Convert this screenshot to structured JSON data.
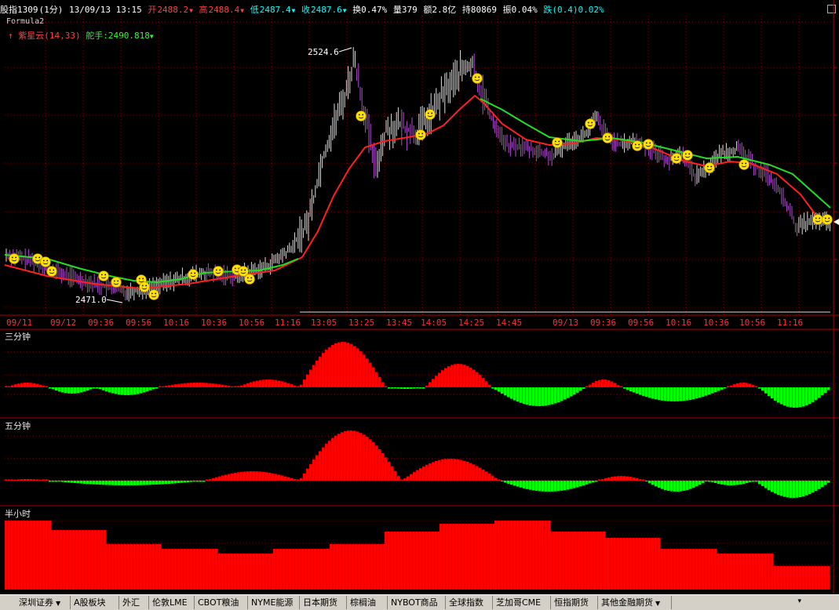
{
  "status": {
    "symbol": "股指1309",
    "period": "(1分)",
    "datetime": "13/09/13 13:15",
    "open_label": "开",
    "open": "2488.2",
    "high_label": "高",
    "high": "2488.4",
    "low_label": "低",
    "low": "2487.4",
    "close_label": "收",
    "close": "2487.6",
    "turnover": "换0.47%",
    "volume": "量379",
    "amount": "额2.8亿",
    "holding": "持80869",
    "amplitude": "振0.04%",
    "change": "跌(0.4)0.02%"
  },
  "formula_name": "Formula2",
  "indicators": {
    "name1": "紫星云(14,33)",
    "name2": "舵手:2490.818",
    "color1": "#ff3b3b",
    "color2": "#3cf23c"
  },
  "price_labels": {
    "high_mark": "2524.6",
    "low_mark": "2471.0"
  },
  "time_axis": [
    "09/11",
    "09/12",
    "09:36",
    "09:56",
    "10:16",
    "10:36",
    "10:56",
    "11:16",
    "13:05",
    "13:25",
    "13:45",
    "14:05",
    "14:25",
    "14:45",
    "09/13",
    "09:36",
    "09:56",
    "10:16",
    "10:36",
    "10:56",
    "11:16"
  ],
  "panels": {
    "p1": "三分钟",
    "p2": "五分钟",
    "p3": "半小时"
  },
  "colors": {
    "up": "#ff0000",
    "down": "#00ff00",
    "line_red": "#ff2020",
    "line_green": "#20e020",
    "grid": "#8b0000",
    "candle_up": "#e0e0e0",
    "candle_down": "#b050d0",
    "smiley": "#ffe000"
  },
  "tabs": [
    {
      "label": "深圳证券",
      "arrow": true
    },
    {
      "label": "A股板块"
    },
    {
      "label": "外汇"
    },
    {
      "label": "伦敦LME"
    },
    {
      "label": "CBOT粮油"
    },
    {
      "label": "NYME能源"
    },
    {
      "label": "日本期货"
    },
    {
      "label": "棕榈油"
    },
    {
      "label": "NYBOT商品"
    },
    {
      "label": "全球指数"
    },
    {
      "label": "芝加哥CME"
    },
    {
      "label": "恒指期货"
    },
    {
      "label": "其他金融期货",
      "arrow": true
    }
  ]
}
